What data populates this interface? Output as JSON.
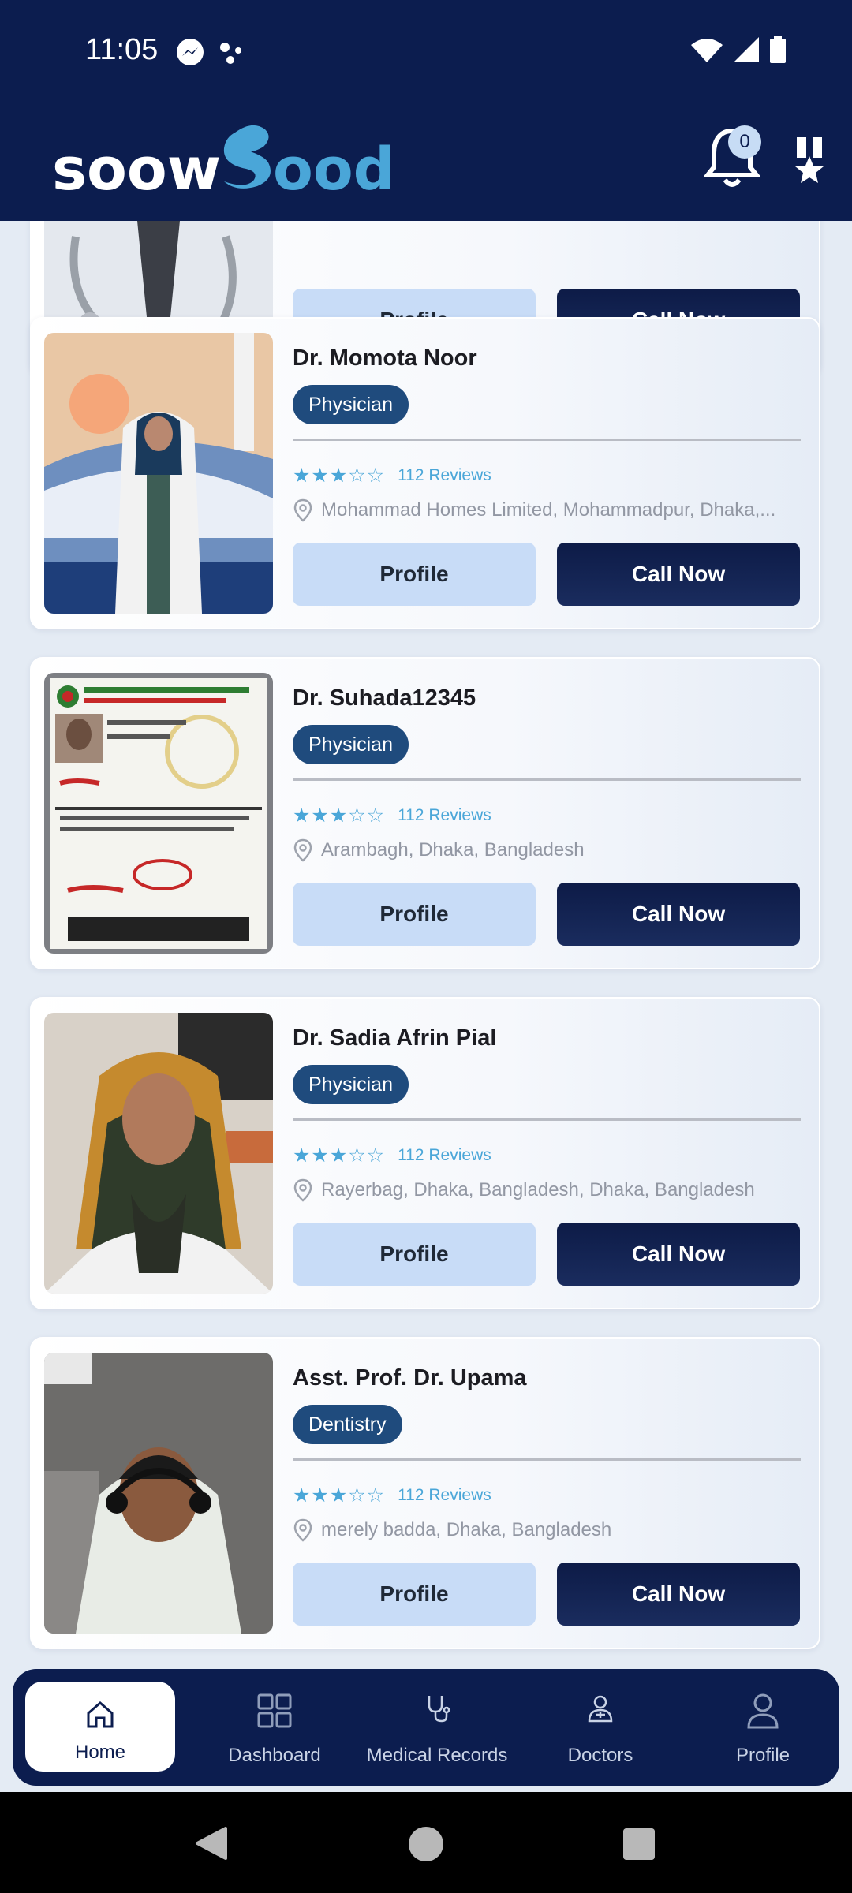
{
  "status_bar": {
    "time": "11:05",
    "icons": [
      "messenger-icon",
      "dots-icon",
      "wifi-icon",
      "signal-icon",
      "battery-icon"
    ]
  },
  "header": {
    "brand": "soowGood",
    "notification_count": "0",
    "icons": [
      "bell-icon",
      "award-icon"
    ]
  },
  "colors": {
    "primary_dark": "#0c1d4f",
    "badge_blue": "#1f4b7d",
    "profile_btn": "#c8dcf7",
    "star": "#4aa6d8"
  },
  "partial_card": {
    "profile_label": "Profile",
    "call_label": "Call Now"
  },
  "doctors": [
    {
      "name": "Dr. Momota Noor",
      "specialty": "Physician",
      "rating": 3,
      "stars": "★★★☆☆",
      "reviews": "112 Reviews",
      "location": "Mohammad Homes Limited, Mohammadpur, Dhaka,...",
      "profile_label": "Profile",
      "call_label": "Call Now"
    },
    {
      "name": "Dr. Suhada12345",
      "specialty": "Physician",
      "rating": 3,
      "stars": "★★★☆☆",
      "reviews": "112 Reviews",
      "location": "Arambagh, Dhaka, Bangladesh",
      "profile_label": "Profile",
      "call_label": "Call Now"
    },
    {
      "name": "Dr. Sadia Afrin Pial",
      "specialty": "Physician",
      "rating": 3,
      "stars": "★★★☆☆",
      "reviews": "112 Reviews",
      "location": "Rayerbag, Dhaka, Bangladesh, Dhaka, Bangladesh",
      "profile_label": "Profile",
      "call_label": "Call Now"
    },
    {
      "name": "Asst. Prof. Dr. Upama",
      "specialty": "Dentistry",
      "rating": 3,
      "stars": "★★★☆☆",
      "reviews": "112 Reviews",
      "location": "merely badda, Dhaka, Bangladesh",
      "profile_label": "Profile",
      "call_label": "Call Now"
    }
  ],
  "bottom_nav": [
    {
      "label": "Home",
      "icon": "home-icon",
      "active": true
    },
    {
      "label": "Dashboard",
      "icon": "dashboard-icon",
      "active": false
    },
    {
      "label": "Medical Records",
      "icon": "stethoscope-icon",
      "active": false
    },
    {
      "label": "Doctors",
      "icon": "doctor-icon",
      "active": false
    },
    {
      "label": "Profile",
      "icon": "user-icon",
      "active": false
    }
  ],
  "system_nav": [
    "back-icon",
    "home-circle-icon",
    "recents-icon"
  ]
}
